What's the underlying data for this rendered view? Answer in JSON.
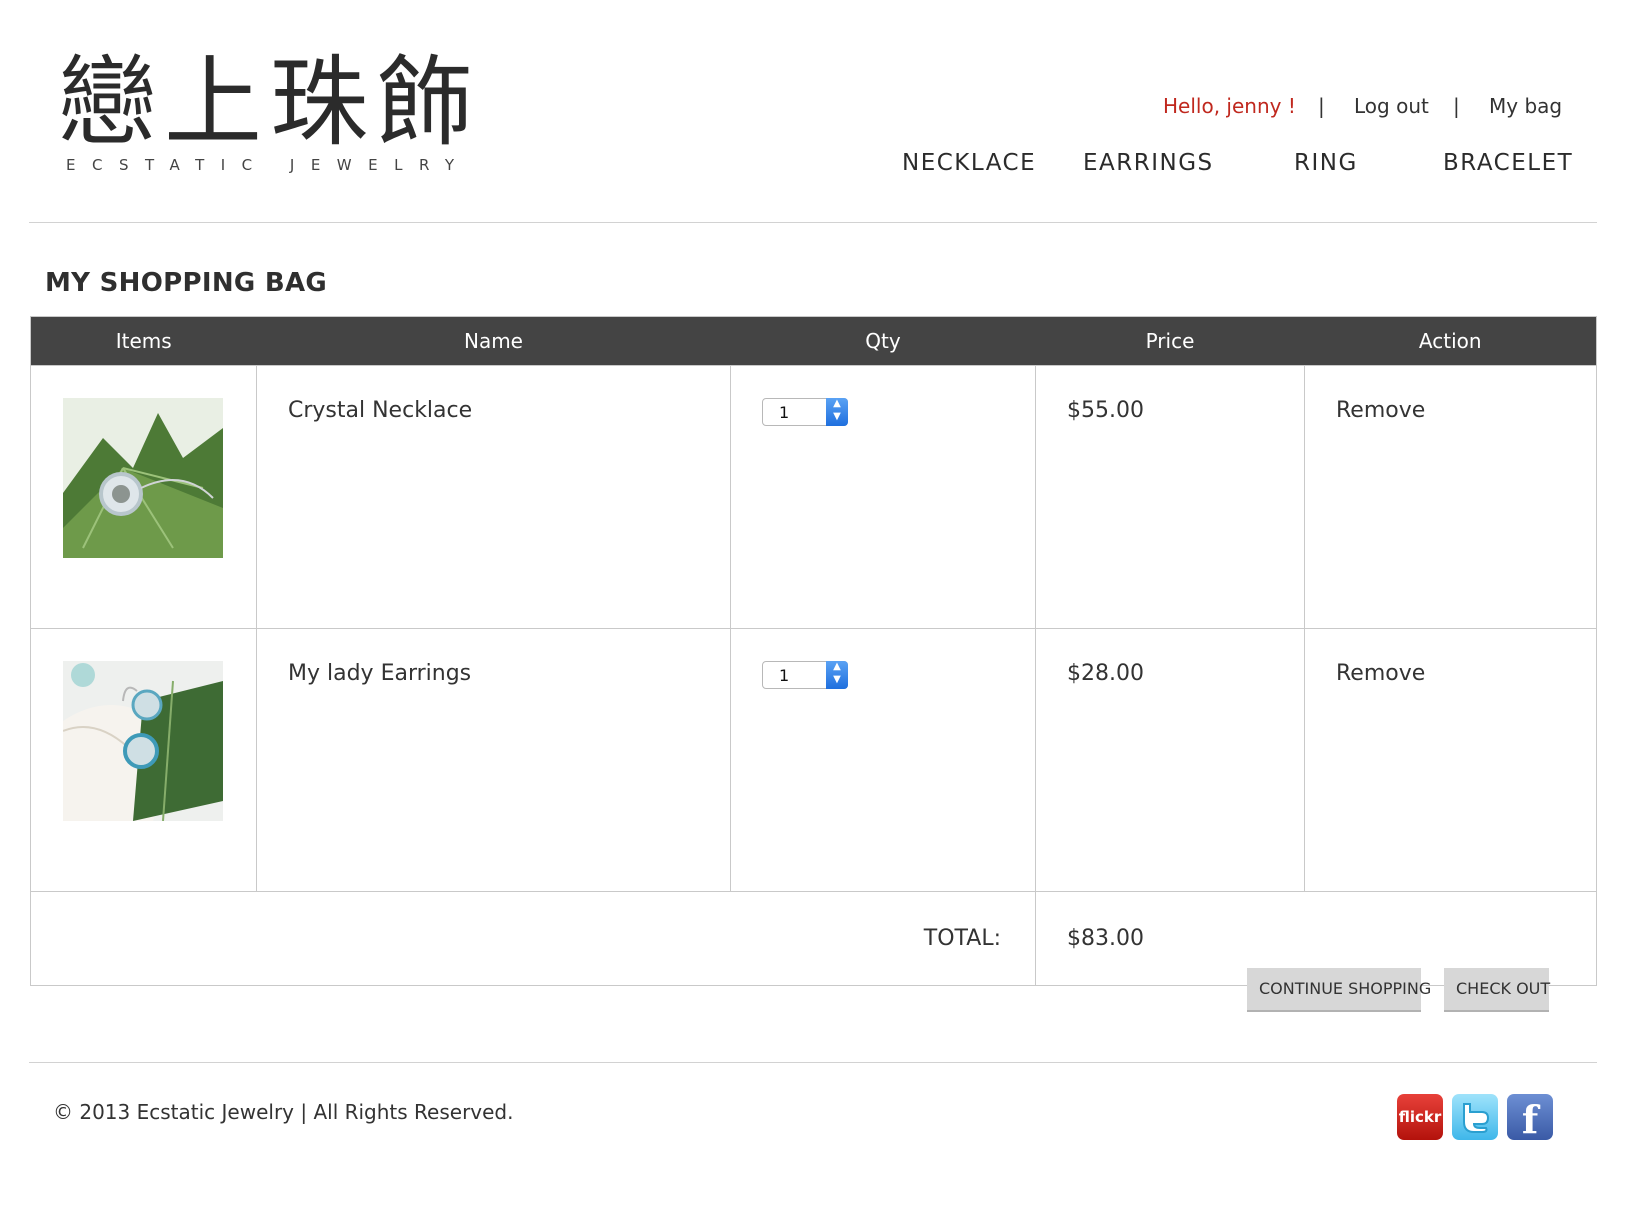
{
  "brand": {
    "logo_chinese": "戀上珠飾",
    "logo_english": "ECSTATIC JEWELRY"
  },
  "account": {
    "greeting": "Hello, jenny !",
    "separator": "|",
    "logout": "Log out",
    "bag": "My bag"
  },
  "nav": [
    "NECKLACE",
    "EARRINGS",
    "RING",
    "BRACELET"
  ],
  "page_title": "MY SHOPPING BAG",
  "table": {
    "headers": [
      "Items",
      "Name",
      "Qty",
      "Price",
      "Action"
    ],
    "rows": [
      {
        "image_icon": "crystal-necklace-photo",
        "name": "Crystal Necklace",
        "qty": "1",
        "price": "$55.00",
        "action": "Remove"
      },
      {
        "image_icon": "lady-earrings-photo",
        "name": "My lady Earrings",
        "qty": "1",
        "price": "$28.00",
        "action": "Remove"
      }
    ],
    "total_label": "TOTAL:",
    "total_value": "$83.00"
  },
  "buttons": {
    "continue": "CONTINUE SHOPPING",
    "checkout": "CHECK OUT"
  },
  "footer": {
    "copyright": "© 2013 Ecstatic Jewelry | All Rights Reserved.",
    "social": [
      {
        "name": "flickr",
        "label": "flickr",
        "color": "#c8201a"
      },
      {
        "name": "twitter",
        "color": "#55c4ef"
      },
      {
        "name": "facebook",
        "label": "f",
        "color": "#4a68b4"
      }
    ]
  },
  "colors": {
    "accent_red": "#c0281e",
    "header_bg": "#444444",
    "button_bg": "#d7d7d7"
  }
}
